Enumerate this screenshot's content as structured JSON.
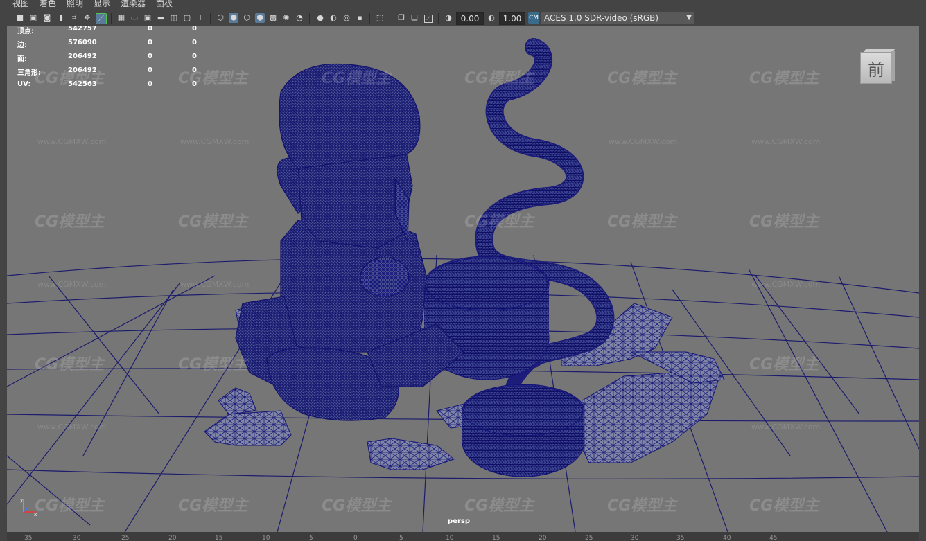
{
  "menu": [
    "视图",
    "着色",
    "照明",
    "显示",
    "渲染器",
    "面板"
  ],
  "toolbar": {
    "icons": [
      "select-camera-icon",
      "camera-attributes-icon",
      "bookmark-icon",
      "image-plane-icon",
      "grid-icon",
      "film-gate-icon",
      "resolution-gate-icon",
      "gate-mask-icon",
      "field-chart-icon",
      "safe-action-icon",
      "safe-title-icon",
      "wireframe-icon",
      "smooth-shade-icon",
      "wireframe-on-shaded-icon",
      "textured-icon",
      "use-all-lights-icon",
      "shadows-icon",
      "ambient-occlusion-icon",
      "motion-blur-icon",
      "anti-aliasing-icon",
      "depth-of-field-icon",
      "isolate-select-icon",
      "xray-icon",
      "xray-joints-icon",
      "backface-culling-icon",
      "exposure-icon",
      "gamma-icon",
      "color-management-icon"
    ],
    "exposure_value": "0.00",
    "gamma_value": "1.00",
    "color_space_badge": "CM",
    "color_space": "ACES 1.0 SDR-video (sRGB)"
  },
  "hud": {
    "rows": [
      {
        "label": "顶点:",
        "v1": "542757",
        "v2": "0",
        "v3": "0"
      },
      {
        "label": "边:",
        "v1": "576090",
        "v2": "0",
        "v3": "0"
      },
      {
        "label": "面:",
        "v1": "206492",
        "v2": "0",
        "v3": "0"
      },
      {
        "label": "三角形:",
        "v1": "206492",
        "v2": "0",
        "v3": "0"
      },
      {
        "label": "UV:",
        "v1": "542563",
        "v2": "0",
        "v3": "0"
      }
    ]
  },
  "view_cube_label": "前",
  "camera_label": "persp",
  "axis_labels": {
    "y": "y",
    "x": "x"
  },
  "watermark": {
    "logo": "CG模型主",
    "url": "www.CGMXW.com"
  },
  "ruler_ticks": [
    "35",
    "30",
    "25",
    "20",
    "15",
    "10",
    "5",
    "0",
    "5",
    "10",
    "15",
    "20",
    "25",
    "30",
    "35",
    "40",
    "45"
  ],
  "colors": {
    "viewport_bg": "#767676",
    "wireframe": "#14147a",
    "grid_lines": "#1c1c6e",
    "ui_bg": "#444444"
  }
}
